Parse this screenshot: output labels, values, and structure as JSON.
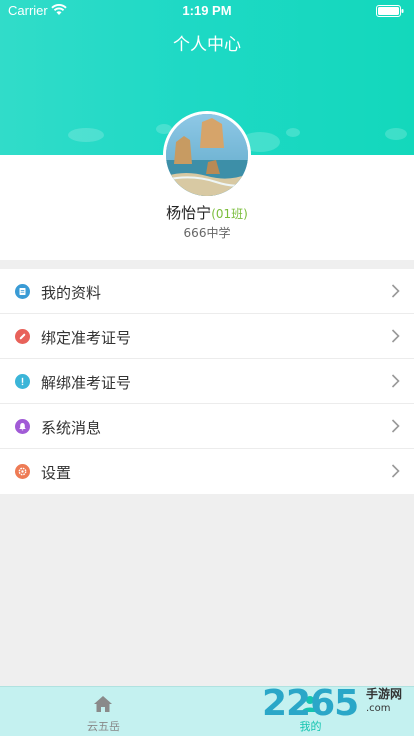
{
  "status_bar": {
    "carrier": "Carrier",
    "time": "1:19 PM"
  },
  "header": {
    "title": "个人中心"
  },
  "profile": {
    "name": "杨怡宁",
    "class_tag": "(01班)",
    "school": "666中学"
  },
  "menu": {
    "items": [
      {
        "label": "我的资料",
        "icon": "profile-doc-icon",
        "color": "#3a9bd5"
      },
      {
        "label": "绑定准考证号",
        "icon": "link-icon",
        "color": "#e8625a"
      },
      {
        "label": "解绑准考证号",
        "icon": "exclamation-icon",
        "color": "#3bb5d8"
      },
      {
        "label": "系统消息",
        "icon": "bell-icon",
        "color": "#a15bd6"
      },
      {
        "label": "设置",
        "icon": "gear-icon",
        "color": "#ee7b55"
      }
    ]
  },
  "tabbar": {
    "home_label": "云五岳",
    "mine_label": "我的"
  },
  "watermark": {
    "number": "2265",
    "sub": "手游网",
    "url": ".com"
  },
  "colors": {
    "accent": "#1ed9c5",
    "class_tag": "#7bbd3c"
  }
}
